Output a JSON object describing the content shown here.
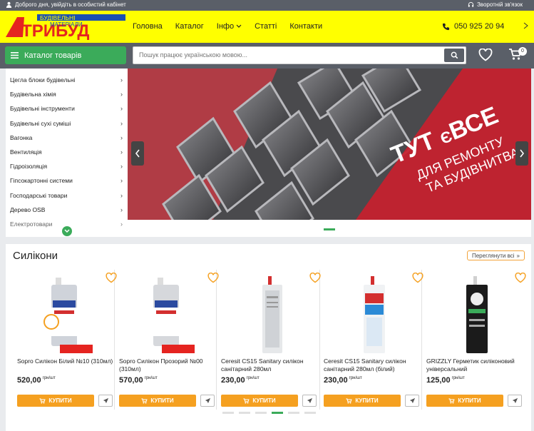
{
  "topbar": {
    "greeting": "Доброго дня, увійдіть в особистий кабінет",
    "feedback": "Зворотній зв'язок"
  },
  "logo": {
    "line1": "БУДІВЕЛЬНІ",
    "line2": "МАТЕРІАЛИ",
    "brand": "АТРИБУД"
  },
  "nav": {
    "items": [
      "Головна",
      "Каталог",
      "Інфо",
      "Статті",
      "Контакти"
    ]
  },
  "phone": "050 925 20 94",
  "catalog_button": "Каталог товарів",
  "search": {
    "placeholder": "Пошук працює українською мовою...",
    "value": ""
  },
  "cart_count": "0",
  "categories": [
    "Цегла блоки будівельні",
    "Будівельна хімія",
    "Будівельні інструменти",
    "Будівельні сухі суміші",
    "Вагонка",
    "Вентиляція",
    "Гідроізоляція",
    "Гіпсокартонні системи",
    "Господарські товари",
    "Дерево OSB",
    "Електротовари"
  ],
  "banner": {
    "line1": "ТУТ",
    "line1b": "Є",
    "line1c": "ВСЕ",
    "line2": "ДЛЯ РЕМОНТУ",
    "line3": "ТА БУДІВНИТВА"
  },
  "section": {
    "title": "Силікони",
    "see_all": "Переглянути всі"
  },
  "currency": "грн/шт",
  "buy_label": "КУПИТИ",
  "products": [
    {
      "name": "Sopro Силікон Білий №10 (310мл)",
      "price": "520,00"
    },
    {
      "name": "Sopro Силікон Прозорий №00 (310мл)",
      "price": "570,00"
    },
    {
      "name": "Ceresit CS15 Sanitary силікон санітарний 280мл",
      "price": "230,00"
    },
    {
      "name": "Ceresit CS15 Sanitary силікон санітарний 280мл (білий)",
      "price": "230,00"
    },
    {
      "name": "GRIZZLY Герметик силіконовий універсальний",
      "price": "125,00"
    }
  ],
  "colors": {
    "accent_green": "#3bab5a",
    "header_yellow": "#ffff00",
    "buy_orange": "#f5a020",
    "bar_grey": "#5a5f68"
  }
}
